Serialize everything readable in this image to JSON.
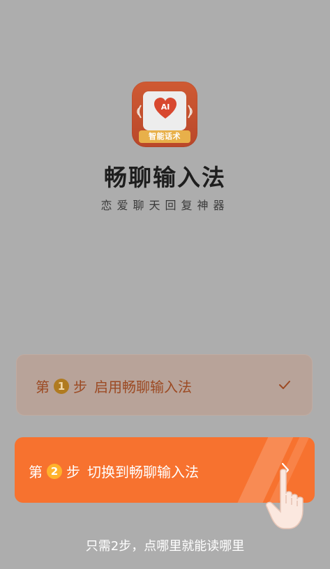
{
  "app": {
    "icon_ai": "AI",
    "icon_banner": "智能话术",
    "name": "畅聊输入法",
    "slogan": "恋爱聊天回复神器"
  },
  "steps": [
    {
      "prefix": "第",
      "number": "1",
      "suffix": "步",
      "action": "启用畅聊输入法",
      "state": "completed",
      "icon": "check-icon"
    },
    {
      "prefix": "第",
      "number": "2",
      "suffix": "步",
      "action": "切换到畅聊输入法",
      "state": "active",
      "icon": "chevron-right-icon"
    }
  ],
  "hint": "只需2步，点哪里就能读哪里",
  "colors": {
    "accent": "#f7722f",
    "step1_bg": "#b8a399",
    "step1_text": "#9c4a23",
    "badge_gold": "#ffb22c"
  }
}
